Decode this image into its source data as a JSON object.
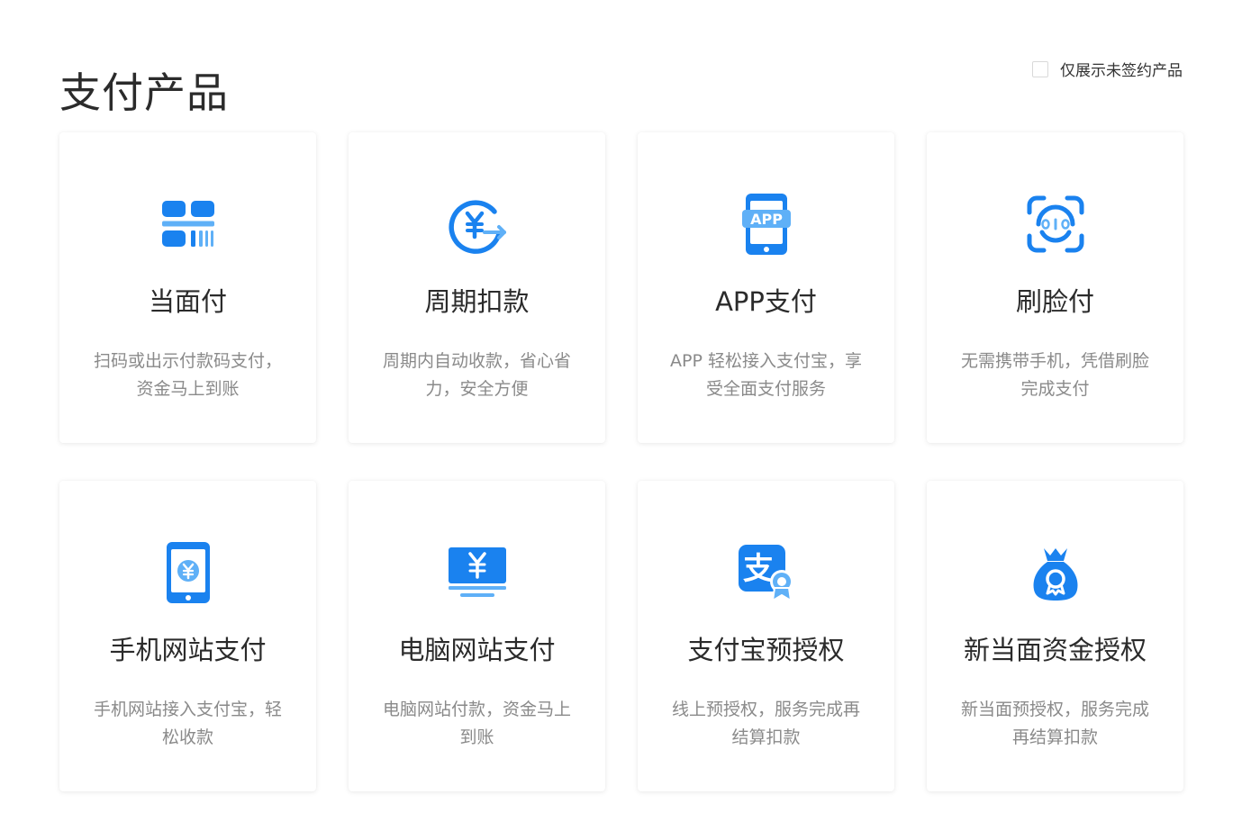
{
  "page": {
    "title": "支付产品",
    "filter_label": "仅展示未签约产品",
    "filter_checked": false
  },
  "colors": {
    "icon_blue": "#1a82ef",
    "icon_light": "#5fb0f7",
    "title": "#2b2b2b",
    "desc": "#8a8a8a"
  },
  "products": [
    {
      "icon": "qr-code-icon",
      "name": "当面付",
      "desc": "扫码或出示付款码支付，资金马上到账"
    },
    {
      "icon": "recurring-payment-icon",
      "name": "周期扣款",
      "desc": "周期内自动收款，省心省力，安全方便"
    },
    {
      "icon": "app-phone-icon",
      "name": "APP支付",
      "desc": "APP 轻松接入支付宝，享受全面支付服务"
    },
    {
      "icon": "face-scan-icon",
      "name": "刷脸付",
      "desc": "无需携带手机，凭借刷脸完成支付"
    },
    {
      "icon": "mobile-web-icon",
      "name": "手机网站支付",
      "desc": "手机网站接入支付宝，轻松收款"
    },
    {
      "icon": "desktop-web-icon",
      "name": "电脑网站支付",
      "desc": "电脑网站付款，资金马上到账"
    },
    {
      "icon": "alipay-preauth-icon",
      "name": "支付宝预授权",
      "desc": "线上预授权，服务完成再结算扣款"
    },
    {
      "icon": "money-bag-icon",
      "name": "新当面资金授权",
      "desc": "新当面预授权，服务完成再结算扣款"
    }
  ]
}
